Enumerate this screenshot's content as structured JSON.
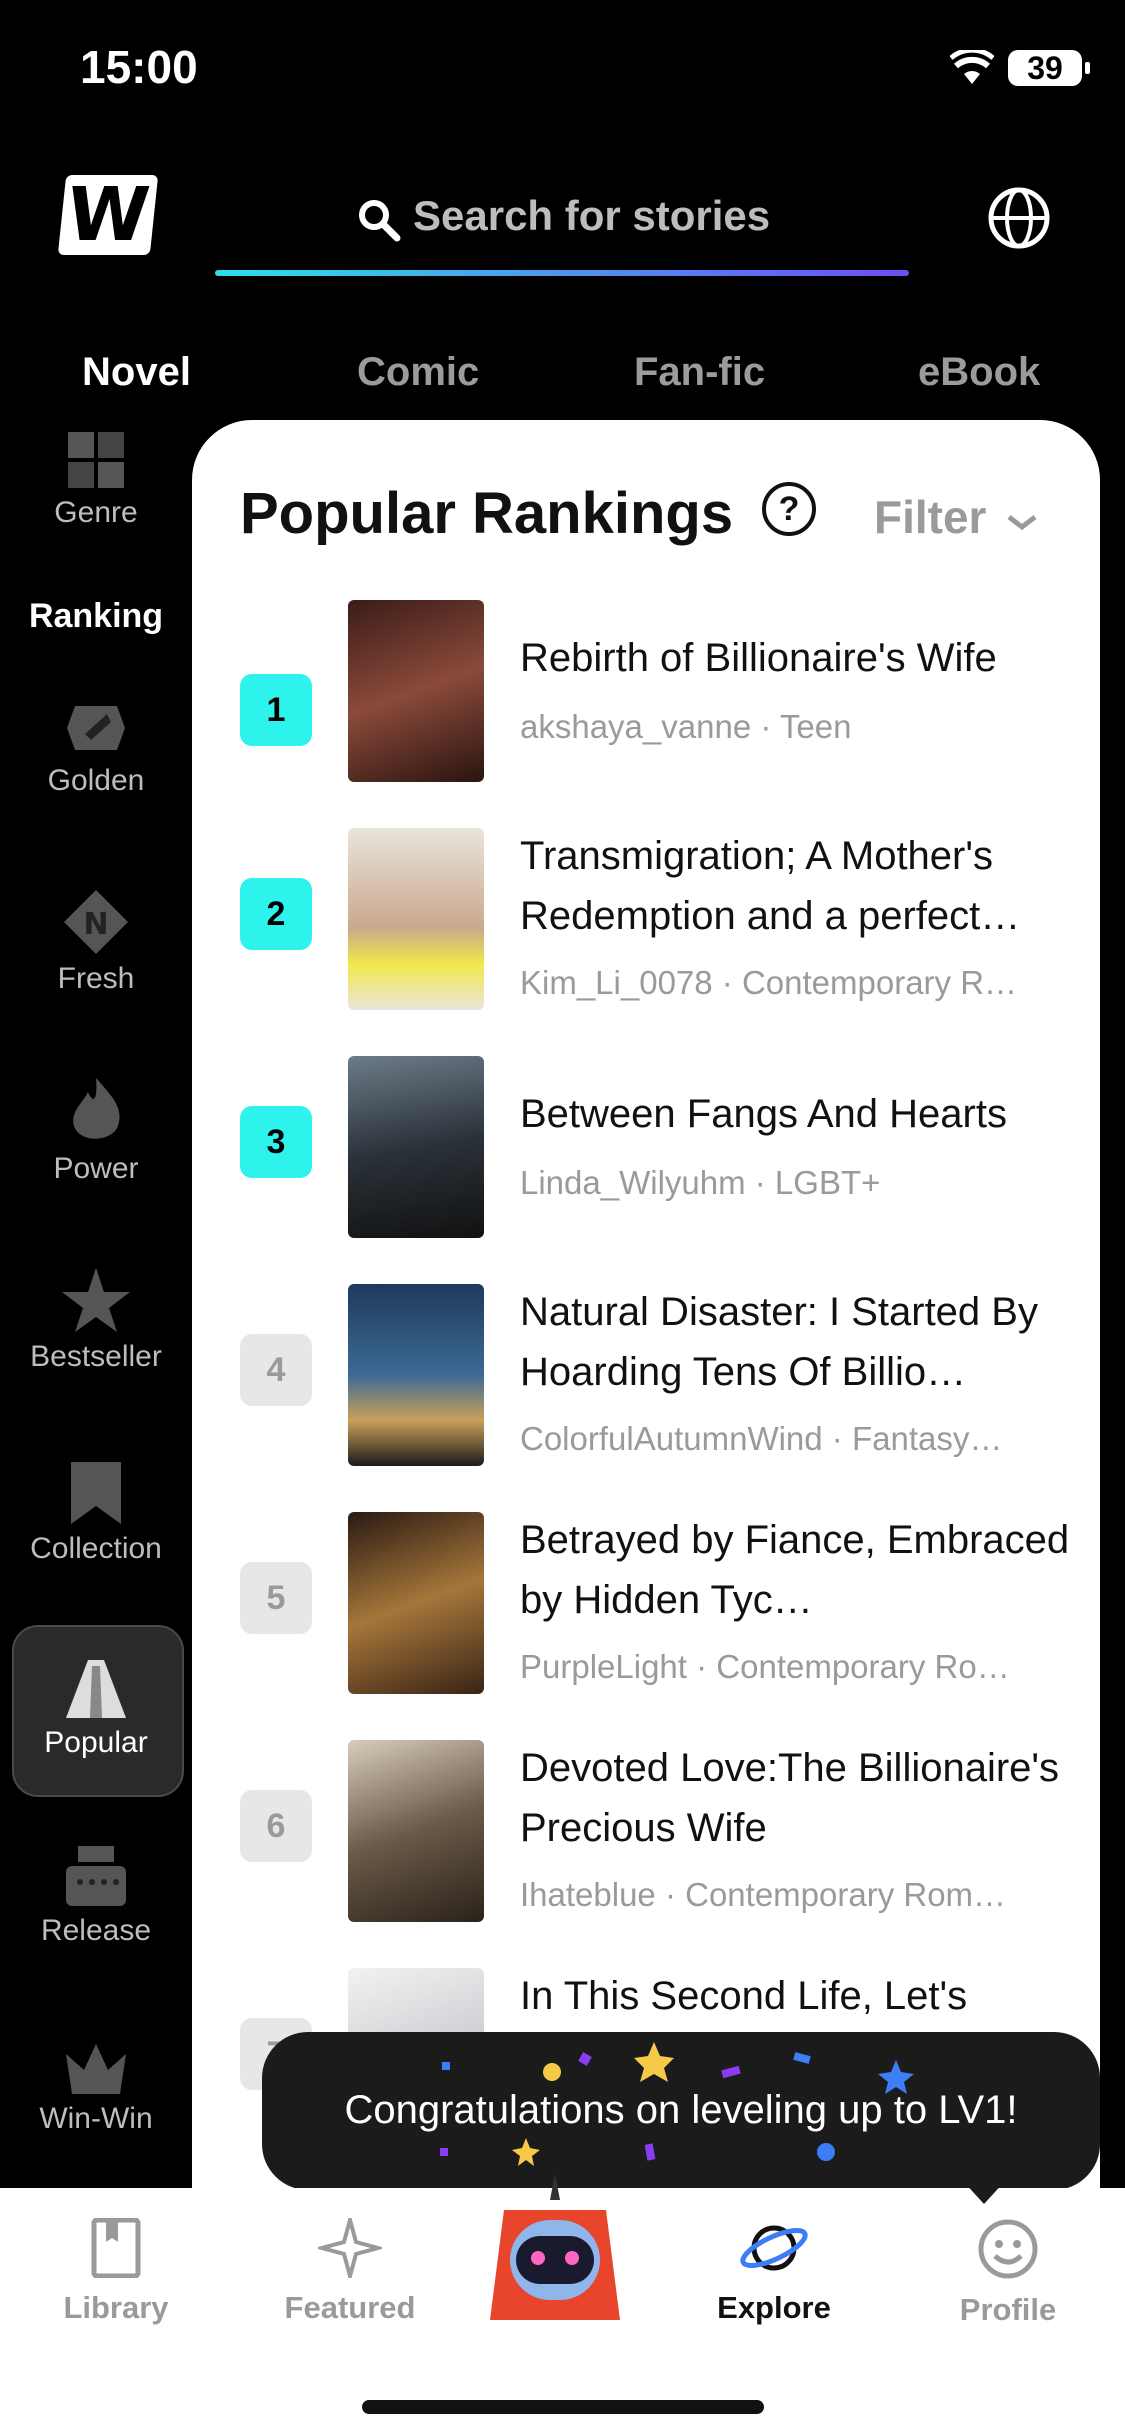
{
  "status": {
    "time": "15:00",
    "battery": "39"
  },
  "search": {
    "placeholder": "Search for stories"
  },
  "tabs": [
    "Novel",
    "Comic",
    "Fan-fic",
    "eBook"
  ],
  "sidebar": {
    "genre": "Genre",
    "ranking": "Ranking",
    "items": [
      "Golden",
      "Fresh",
      "Power",
      "Bestseller",
      "Collection",
      "Popular",
      "Release",
      "Win-Win"
    ]
  },
  "card": {
    "title": "Popular Rankings",
    "filter": "Filter"
  },
  "books": [
    {
      "rank": "1",
      "title": "Rebirth of Billionaire's Wife",
      "meta": "akshaya_vanne · Teen"
    },
    {
      "rank": "2",
      "title": "Transmigration; A Mother's Redemption and a perfect…",
      "meta": "Kim_Li_0078 · Contemporary R…"
    },
    {
      "rank": "3",
      "title": "Between Fangs And Hearts",
      "meta": "Linda_Wilyuhm · LGBT+"
    },
    {
      "rank": "4",
      "title": "Natural Disaster: I Started By Hoarding Tens Of Billio…",
      "meta": "ColorfulAutumnWind · Fantasy…"
    },
    {
      "rank": "5",
      "title": "Betrayed by Fiance, Embraced by Hidden Tyc…",
      "meta": "PurpleLight · Contemporary Ro…"
    },
    {
      "rank": "6",
      "title": "Devoted Love:The Billionaire's Precious Wife",
      "meta": "Ihateblue · Contemporary Rom…"
    },
    {
      "rank": "7",
      "title": "In This Second Life, Let's",
      "meta": ""
    }
  ],
  "toast": {
    "text": "Congratulations on leveling up to LV1!"
  },
  "bottom_nav": [
    "Library",
    "Featured",
    "Explore",
    "Profile"
  ],
  "colors": {
    "accent": "#2ef2ec",
    "gradient_start": "#2de0e8",
    "gradient_end": "#6d4df2"
  }
}
